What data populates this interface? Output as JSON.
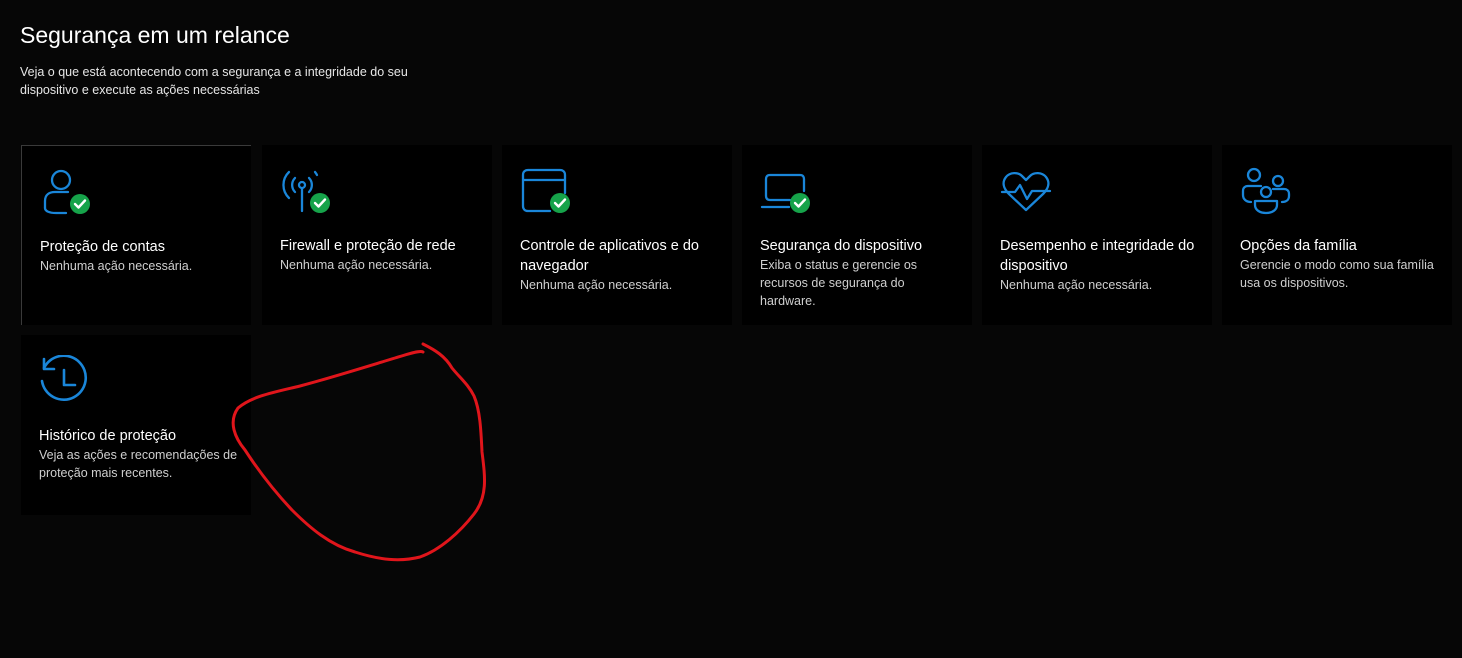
{
  "header": {
    "title": "Segurança em um relance",
    "subtitle": "Veja o que está acontecendo com a segurança e a integridade do seu dispositivo e execute as ações necessárias"
  },
  "colors": {
    "accent": "#1a86d9",
    "ok": "#16a34a",
    "annotation": "#e0151b"
  },
  "tiles": [
    {
      "icon": "account-protection-icon",
      "status_ok": true,
      "title": "Proteção de contas",
      "description": "Nenhuma ação necessária."
    },
    {
      "icon": "firewall-network-icon",
      "status_ok": true,
      "title": "Firewall e proteção de rede",
      "description": "Nenhuma ação necessária."
    },
    {
      "icon": "app-browser-control-icon",
      "status_ok": true,
      "title": "Controle de aplicativos e do navegador",
      "description": "Nenhuma ação necessária."
    },
    {
      "icon": "device-security-icon",
      "status_ok": true,
      "title": "Segurança do dispositivo",
      "description": "Exiba o status e gerencie os recursos de segurança do hardware."
    },
    {
      "icon": "device-performance-health-icon",
      "status_ok": false,
      "title": "Desempenho e integridade do dispositivo",
      "description": "Nenhuma ação necessária."
    },
    {
      "icon": "family-options-icon",
      "status_ok": false,
      "title": "Opções da família",
      "description": "Gerencie o modo como sua família usa os dispositivos."
    },
    {
      "icon": "protection-history-icon",
      "status_ok": false,
      "title": "Histórico de proteção",
      "description": "Veja as ações e recomendações de proteção mais recentes."
    }
  ]
}
